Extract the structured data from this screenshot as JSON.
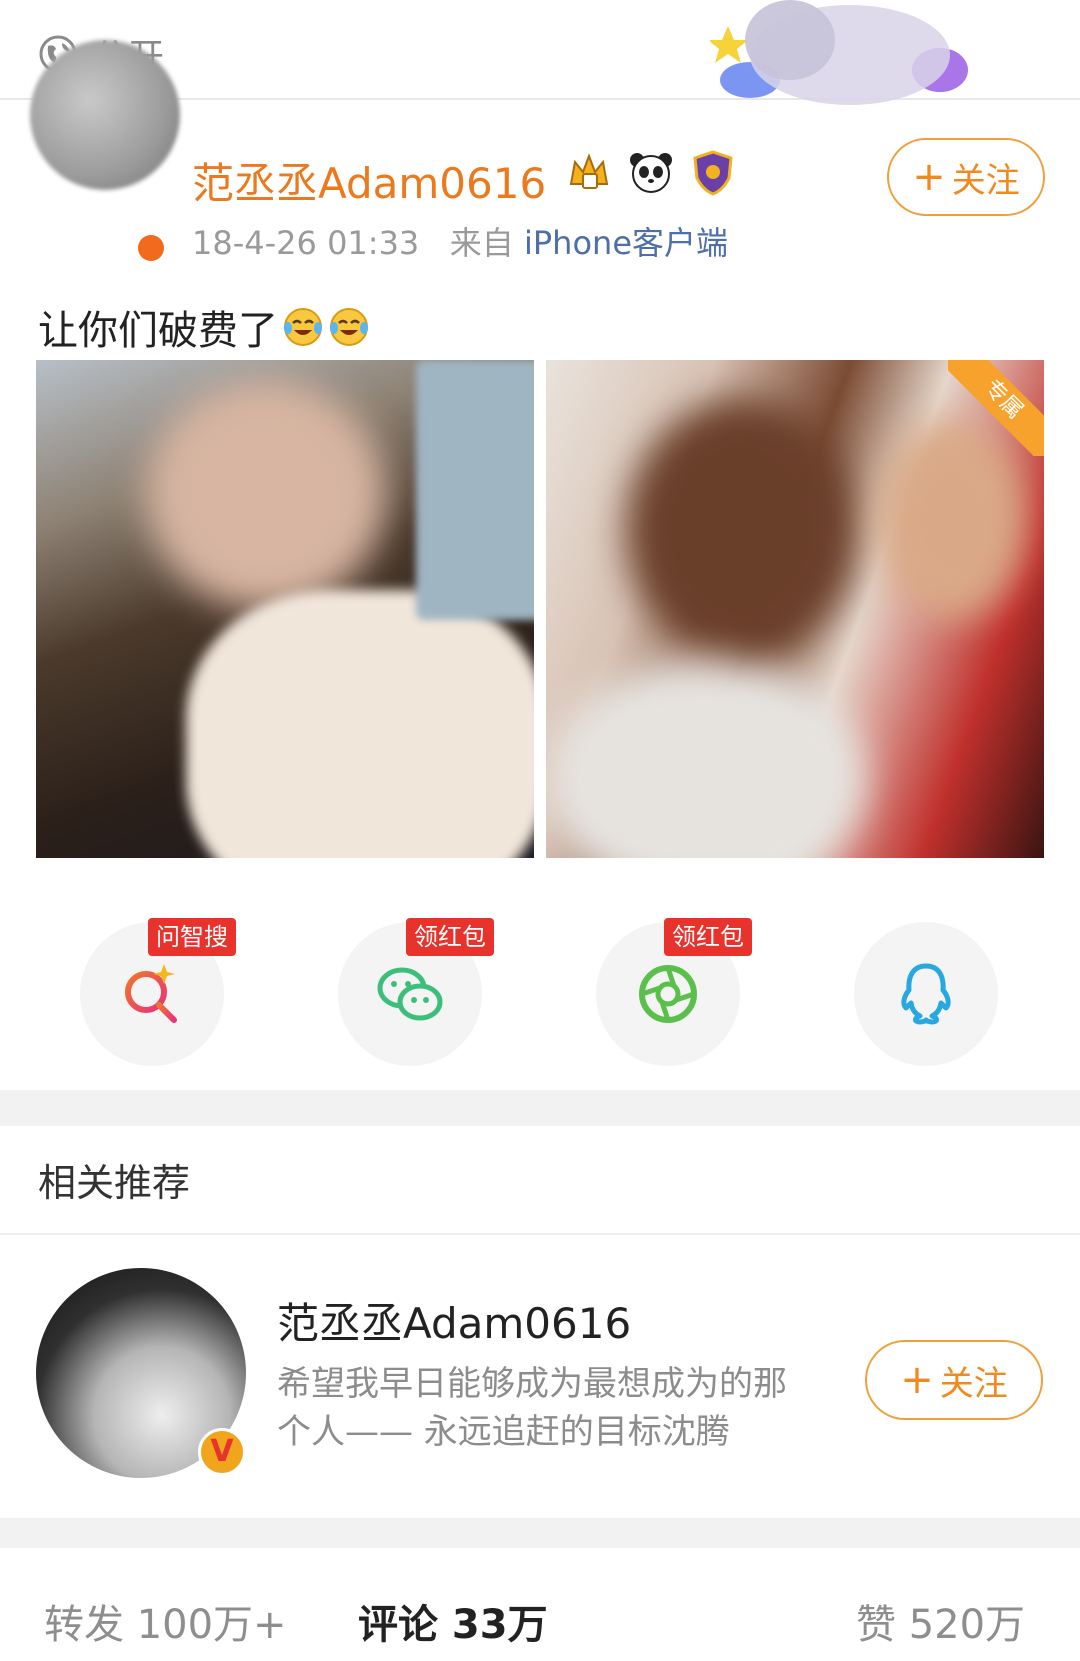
{
  "topbar": {
    "visibility_label": "公开",
    "visibility_icon": "globe-icon"
  },
  "post": {
    "author": "范丞丞Adam0616",
    "badges": [
      "crown-badge-icon",
      "panda-badge-icon",
      "shield-badge-icon"
    ],
    "time": "18-4-26 01:33",
    "from_prefix": "来自",
    "source": "iPhone客户端",
    "follow_label": "关注",
    "text": "让你们破费了",
    "emoji": "laugh-cry-emoji",
    "exclusive_tag": "专属"
  },
  "share": [
    {
      "icon": "smart-search-icon",
      "tag": "问智搜",
      "color": "#e8322c"
    },
    {
      "icon": "wechat-icon",
      "tag": "领红包",
      "color": "#3cbf7a"
    },
    {
      "icon": "moments-icon",
      "tag": "领红包",
      "color": "#5ac04b"
    },
    {
      "icon": "qq-icon",
      "tag": "",
      "color": "#27a8e0"
    }
  ],
  "recommend": {
    "title": "相关推荐",
    "name": "范丞丞Adam0616",
    "desc_line1": "希望我早日能够成为最想成为的那",
    "desc_line2": "个人—— 永远追赶的目标沈腾",
    "verified": "V",
    "follow_label": "关注"
  },
  "stats": {
    "repost": "转发 100万+",
    "comment": "评论 33万",
    "like": "赞 520万"
  }
}
